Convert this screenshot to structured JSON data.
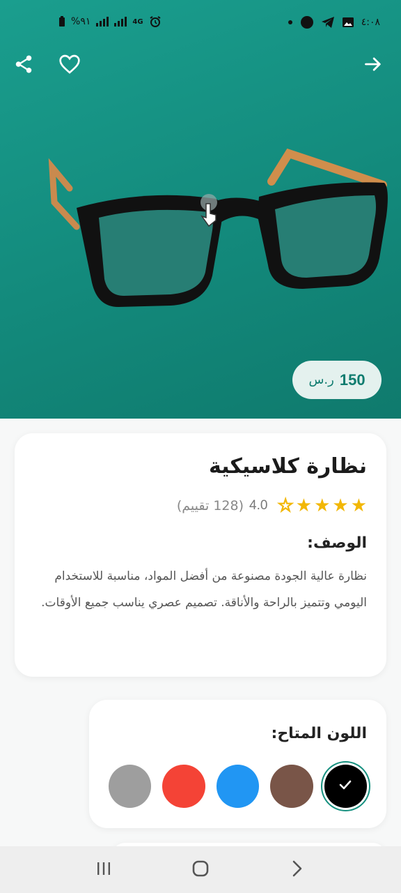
{
  "status_bar": {
    "battery_text": "%٩١",
    "network_label": "4G",
    "time": "٤:٠٨"
  },
  "header": {
    "back_icon": "arrow-right-icon",
    "favorite_icon": "heart-outline-icon",
    "share_icon": "share-icon"
  },
  "product": {
    "price_amount": "150",
    "price_currency": "ر.س",
    "title": "نظارة كلاسيكية",
    "rating_value": "4.0",
    "rating_count": "(128 تقييم)",
    "stars_filled": 4,
    "stars_total": 5,
    "description_label": "الوصف:",
    "description": "نظارة عالية الجودة مصنوعة من أفضل المواد، مناسبة للاستخدام اليومي وتتميز بالراحة والأناقة. تصميم عصري يناسب جميع الأوقات."
  },
  "colors": {
    "label": "اللون المتاح:",
    "options": [
      {
        "name": "black",
        "hex": "#000000",
        "selected": true
      },
      {
        "name": "brown",
        "hex": "#795548",
        "selected": false
      },
      {
        "name": "blue",
        "hex": "#2196f3",
        "selected": false
      },
      {
        "name": "red",
        "hex": "#f44336",
        "selected": false
      },
      {
        "name": "gray",
        "hex": "#9e9e9e",
        "selected": false
      }
    ]
  },
  "theme": {
    "accent": "#16907f",
    "star": "#f2b705"
  }
}
